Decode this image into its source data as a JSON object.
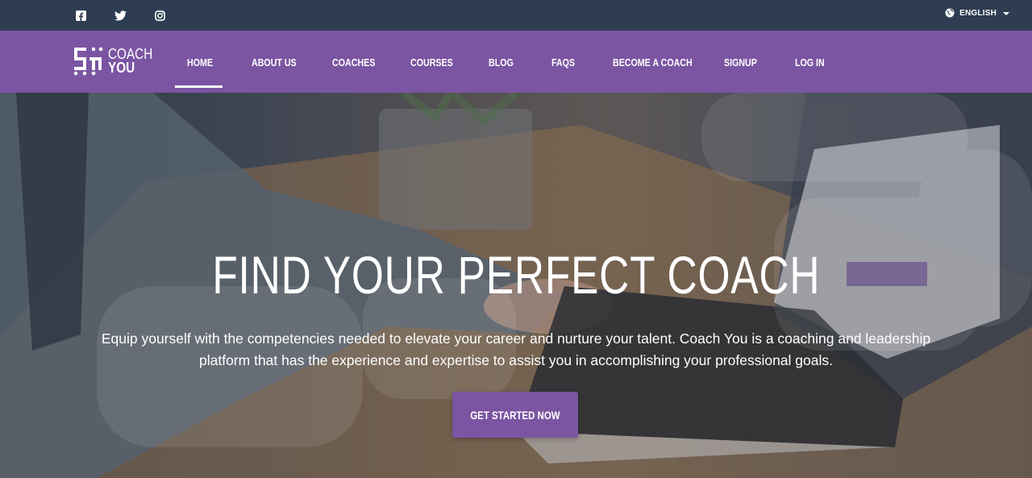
{
  "topbar": {
    "social_icons": [
      "facebook-icon",
      "twitter-icon",
      "instagram-icon"
    ],
    "language_icon": "globe-icon",
    "language_label": "ENGLISH"
  },
  "brand": {
    "logo_line1": "COACH",
    "logo_line2": "YOU"
  },
  "nav": {
    "items": [
      {
        "label": "HOME",
        "active": true
      },
      {
        "label": "ABOUT US"
      },
      {
        "label": "COACHES"
      },
      {
        "label": "COURSES"
      },
      {
        "label": "BLOG"
      },
      {
        "label": "FAQS"
      },
      {
        "label": "BECOME A COACH"
      },
      {
        "label": "SIGNUP"
      },
      {
        "label": "LOG IN"
      }
    ]
  },
  "hero": {
    "title": "FIND YOUR PERFECT COACH",
    "text_line1": "Equip yourself with the competencies needed to elevate your career and nurture your talent. Coach You is a coaching and leadership",
    "text_line2": "platform that has the experience and expertise to assist you in accomplishing your professional goals.",
    "cta_label": "GET STARTED NOW"
  },
  "colors": {
    "topbar_bg": "#2e3d51",
    "brand_purple": "#7b55a2",
    "text_white": "#ffffff"
  }
}
